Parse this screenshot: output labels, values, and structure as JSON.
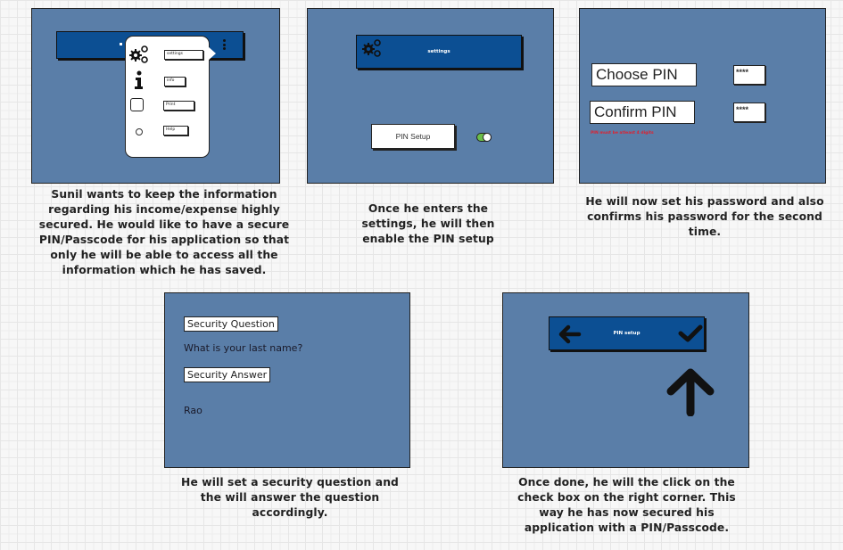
{
  "colors": {
    "panel_bg": "#5a7ea8",
    "appbar_bg": "#0c4f93",
    "toggle_on": "#6bbf4a",
    "error_text": "#e0202e"
  },
  "panels": [
    {
      "id": "menu",
      "menu_items": [
        {
          "icon": "gears-icon",
          "label": "settings"
        },
        {
          "icon": "info-icon",
          "label": "info"
        },
        {
          "icon": "checkbox-icon",
          "label": "Print"
        },
        {
          "icon": "help-icon",
          "label": "Help"
        }
      ],
      "overflow_icon": "kebab-menu-icon",
      "caption": "Sunil wants to keep the information regarding his income/expense highly secured. He would like to have a secure PIN/Passcode for his application so that only he will be able to access all the information which he has saved."
    },
    {
      "id": "settings",
      "appbar_title": "settings",
      "appbar_icon": "gears-icon",
      "pin_setup_label": "PIN Setup",
      "pin_toggle_on": true,
      "caption": "Once he enters the settings, he will then enable the PIN setup"
    },
    {
      "id": "choose-pin",
      "choose_label": "Choose PIN",
      "choose_value": "****",
      "confirm_label": "Confirm PIN",
      "confirm_value": "****",
      "error": "PIN must be atleast 4 digits",
      "caption": "He will now set his password and also confirms his password for the second time."
    },
    {
      "id": "security",
      "question_label": "Security Question",
      "question_text": "What is your last name?",
      "answer_label": "Security Answer",
      "answer_text": "Rao",
      "caption": "He will set a security question and the will answer the question accordingly."
    },
    {
      "id": "pin-setup-confirm",
      "appbar_title": "PIN setup",
      "back_icon": "arrow-left-icon",
      "confirm_icon": "checkmark-icon",
      "pointer_icon": "arrow-up-icon",
      "caption": "Once done, he will the click on the check box on the right corner. This way he has now secured his application with a PIN/Passcode."
    }
  ]
}
